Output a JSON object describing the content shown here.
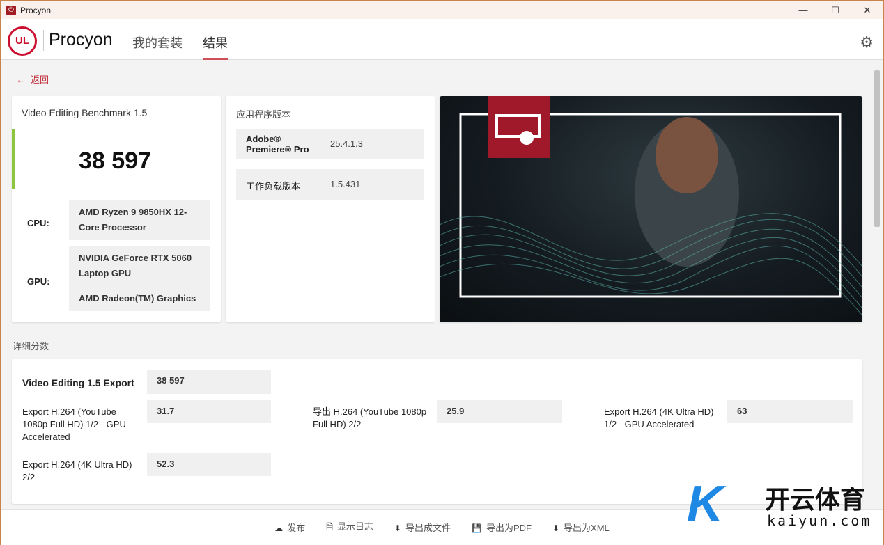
{
  "window": {
    "title": "Procyon",
    "minimize": "—",
    "maximize": "☐",
    "close": "✕"
  },
  "header": {
    "brand": "Procyon",
    "logo_text": "UL",
    "nav": [
      "我的套装",
      "结果"
    ],
    "active_tab": "结果"
  },
  "back_label": "返回",
  "score_card": {
    "title": "Video Editing Benchmark 1.5",
    "score": "38 597",
    "cpu_label": "CPU:",
    "cpu": "AMD Ryzen 9 9850HX 12-Core Processor",
    "gpu_label": "GPU:",
    "gpu1": "NVIDIA GeForce RTX 5060 Laptop GPU",
    "gpu2": "AMD Radeon(TM) Graphics",
    "accent": "#8cc63f"
  },
  "version_card": {
    "title": "应用程序版本",
    "rows": [
      {
        "name": "Adobe® Premiere® Pro",
        "value": "25.4.1.3"
      },
      {
        "name": "工作负载版本",
        "value": "1.5.431"
      }
    ]
  },
  "details": {
    "title": "详细分数",
    "main_label": "Video Editing 1.5 Export",
    "main_value": "38 597",
    "items": [
      {
        "label": "Export H.264 (YouTube 1080p Full HD) 1/2 - GPU Accelerated",
        "value": "31.7"
      },
      {
        "label": "导出 H.264 (YouTube 1080p Full HD) 2/2",
        "value": "25.9"
      },
      {
        "label": "Export H.264 (4K Ultra HD) 1/2 - GPU Accelerated",
        "value": "63"
      },
      {
        "label": "Export H.264 (4K Ultra HD) 2/2",
        "value": "52.3"
      }
    ]
  },
  "footer": [
    {
      "icon": "cloud-upload-icon",
      "glyph": "☁",
      "label": "发布"
    },
    {
      "icon": "document-icon",
      "glyph": "🗎",
      "label": "显示日志"
    },
    {
      "icon": "download-icon",
      "glyph": "⬇",
      "label": "导出成文件"
    },
    {
      "icon": "save-icon",
      "glyph": "💾",
      "label": "导出为PDF"
    },
    {
      "icon": "download-icon",
      "glyph": "⬇",
      "label": "导出为XML"
    }
  ],
  "watermark": {
    "cn": "开云体育",
    "en": "kaiyun.com"
  }
}
